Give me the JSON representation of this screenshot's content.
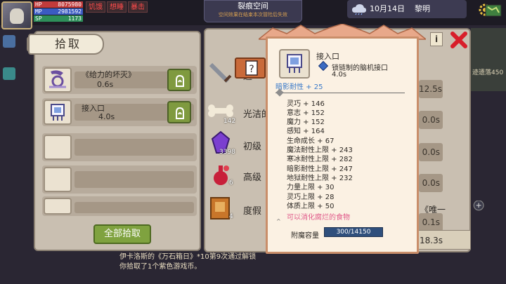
{
  "hud": {
    "hp_label": "HP",
    "hp_value": "8075980",
    "mp_label": "MP",
    "mp_value": "2981592",
    "sp_label": "SP",
    "sp_value": "1173",
    "buffs": [
      "饥饿",
      "想睡",
      "暴击"
    ]
  },
  "rift": {
    "title": "裂痕空间",
    "subtitle": "空间效果在结束本次冒险后失效"
  },
  "clock": {
    "date": "10月14日",
    "time_of_day": "黎明"
  },
  "map_snippet": "迹遗落450",
  "left_panel": {
    "tab_label": "拾取",
    "items": [
      {
        "name": "《给力的坏灭》",
        "time": "0.6s"
      },
      {
        "name": "接入口",
        "time": "4.0s"
      }
    ],
    "pick_all": "全部拾取"
  },
  "middle_panel": {
    "rows": [
      {
        "name": "避",
        "count": "",
        "right": "12.5s"
      },
      {
        "name": "光洁的",
        "count": "142",
        "right": "0.0s"
      },
      {
        "name": "初级",
        "count": "3398",
        "right": "0.0s"
      },
      {
        "name": "高级",
        "count": "6",
        "right": "0.0s"
      },
      {
        "name": "度假",
        "count": "4",
        "right": "0.1s"
      }
    ],
    "right_tag": "《唯一",
    "timer": "18.3s"
  },
  "log": {
    "line1": "伊卡洛斯的《万石箱日》*10第9次通过解锁",
    "line2": "你拾取了1个紫色游戏币。"
  },
  "popup": {
    "name": "接入口",
    "subtitle": "锁链制的脑机接口",
    "time": "4.0s",
    "shadow_resist": "暗影耐性 + 25",
    "stats": [
      "灵巧 + 146",
      "意志 + 152",
      "魔力 + 152",
      "感知 + 164",
      "生命成长 + 67",
      "魔法耐性上限 + 243",
      "寒冰耐性上限 + 282",
      "暗影耐性上限 + 247",
      "地狱耐性上限 + 232",
      "力量上限 + 30",
      "灵巧上限 + 28",
      "体质上限 + 50"
    ],
    "note": "可以消化腐烂的食物",
    "capacity_label": "附魔容量",
    "capacity_value": "300/14150"
  },
  "colors": {
    "accent_green": "#7fa23f",
    "popup_border": "#c98e6a",
    "shadow_blue": "#3a7ac9",
    "note_pink": "#e05a8a"
  }
}
